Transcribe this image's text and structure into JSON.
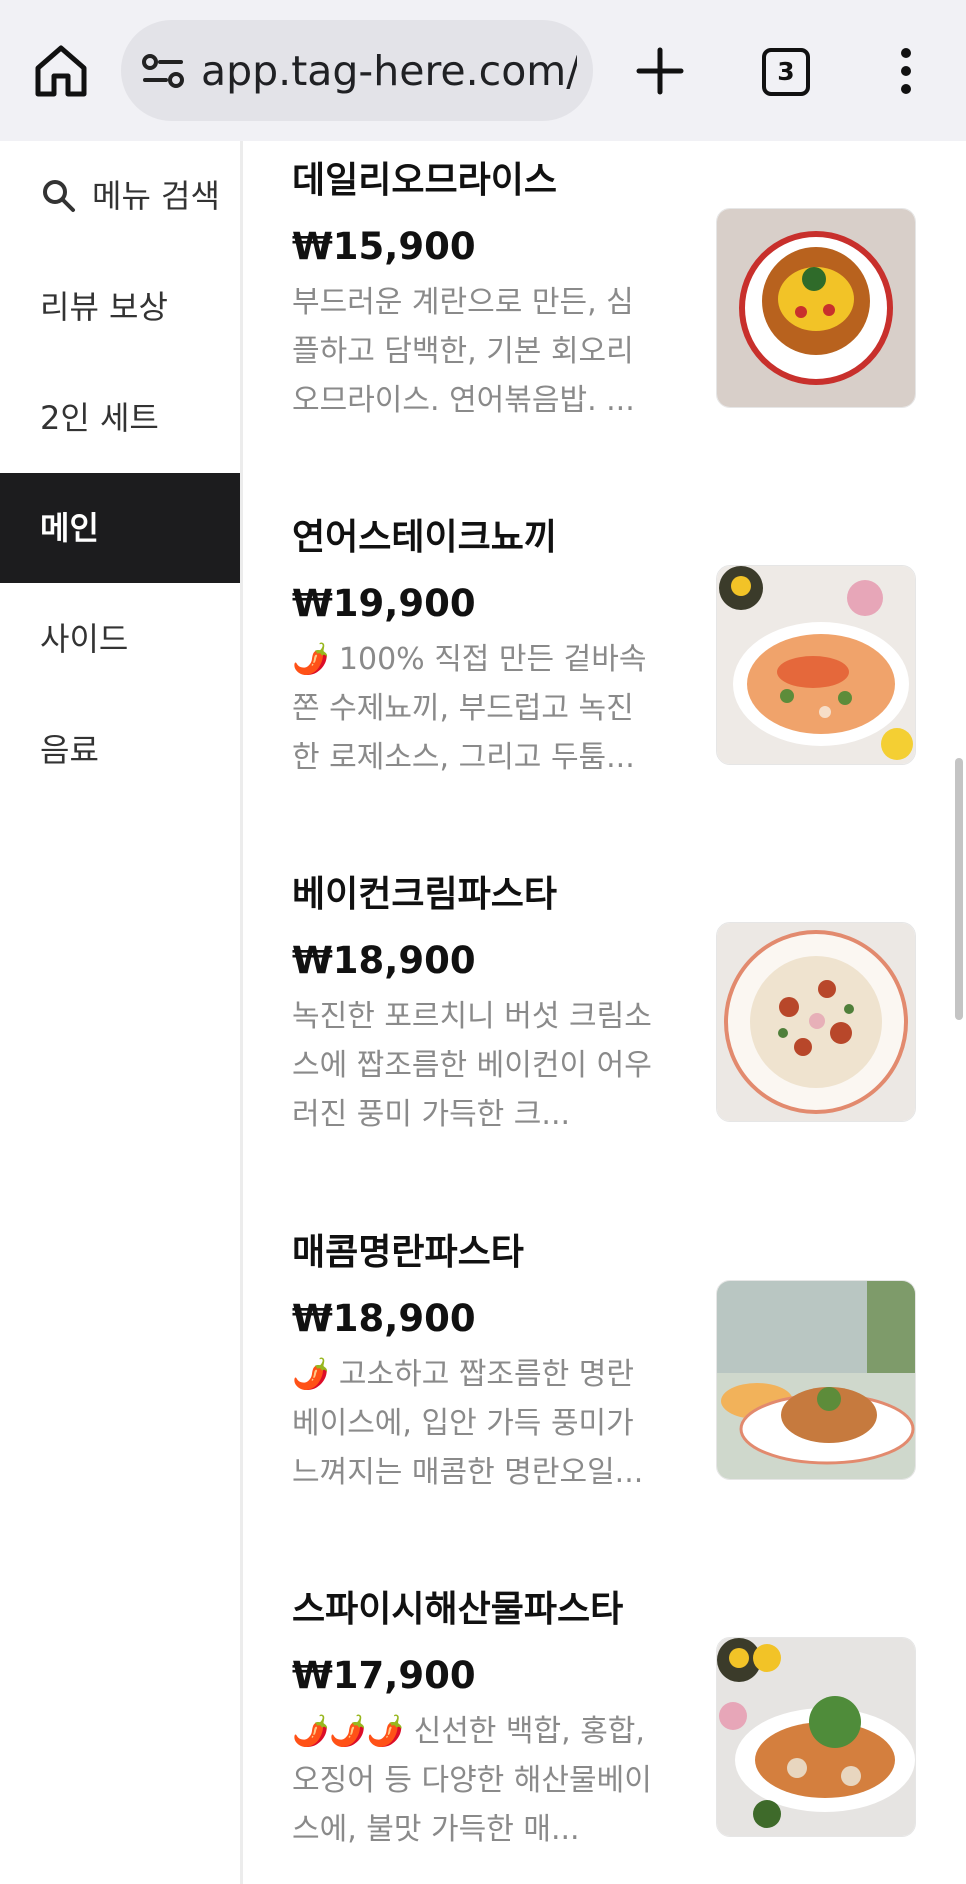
{
  "browser": {
    "url": "app.tag-here.com/st",
    "tab_count": "3",
    "icons": [
      "home-icon",
      "site-settings-icon",
      "new-tab-icon",
      "tabs-icon",
      "more-menu-icon"
    ]
  },
  "sidebar": {
    "items": [
      {
        "label": "메뉴 검색",
        "icon": "search-icon"
      },
      {
        "label": "리뷰 보상"
      },
      {
        "label": "2인 세트"
      },
      {
        "label": "메인",
        "active": true
      },
      {
        "label": "사이드"
      },
      {
        "label": "음료"
      }
    ]
  },
  "menu": {
    "items": [
      {
        "name": "데일리오므라이스",
        "price": "₩15,900",
        "description": "부드러운 계란으로 만든, 심플하고 담백한, 기본 회오리 오므라이스. 연어볶음밥. ..."
      },
      {
        "name": "연어스테이크뇨끼",
        "price": "₩19,900",
        "description": "🌶️ 100% 직접 만든 겉바속쫀 수제뇨끼, 부드럽고 녹진한 로제소스, 그리고 두툼..."
      },
      {
        "name": "베이컨크림파스타",
        "price": "₩18,900",
        "description": "녹진한 포르치니 버섯 크림소스에 짭조름한 베이컨이 어우러진 풍미 가득한 크..."
      },
      {
        "name": "매콤명란파스타",
        "price": "₩18,900",
        "description": "🌶️ 고소하고 짭조름한 명란베이스에, 입안 가득 풍미가 느껴지는 매콤한 명란오일..."
      },
      {
        "name": "스파이시해산물파스타",
        "price": "₩17,900",
        "description": "🌶️🌶️🌶️ 신선한 백합, 홍합, 오징어 등 다양한 해산물베이스에, 불맛 가득한 매..."
      }
    ]
  },
  "colors": {
    "active_bg": "#1c1c1e",
    "desc_text": "#8a8a8a",
    "topbar_bg": "#f1f1f5"
  }
}
